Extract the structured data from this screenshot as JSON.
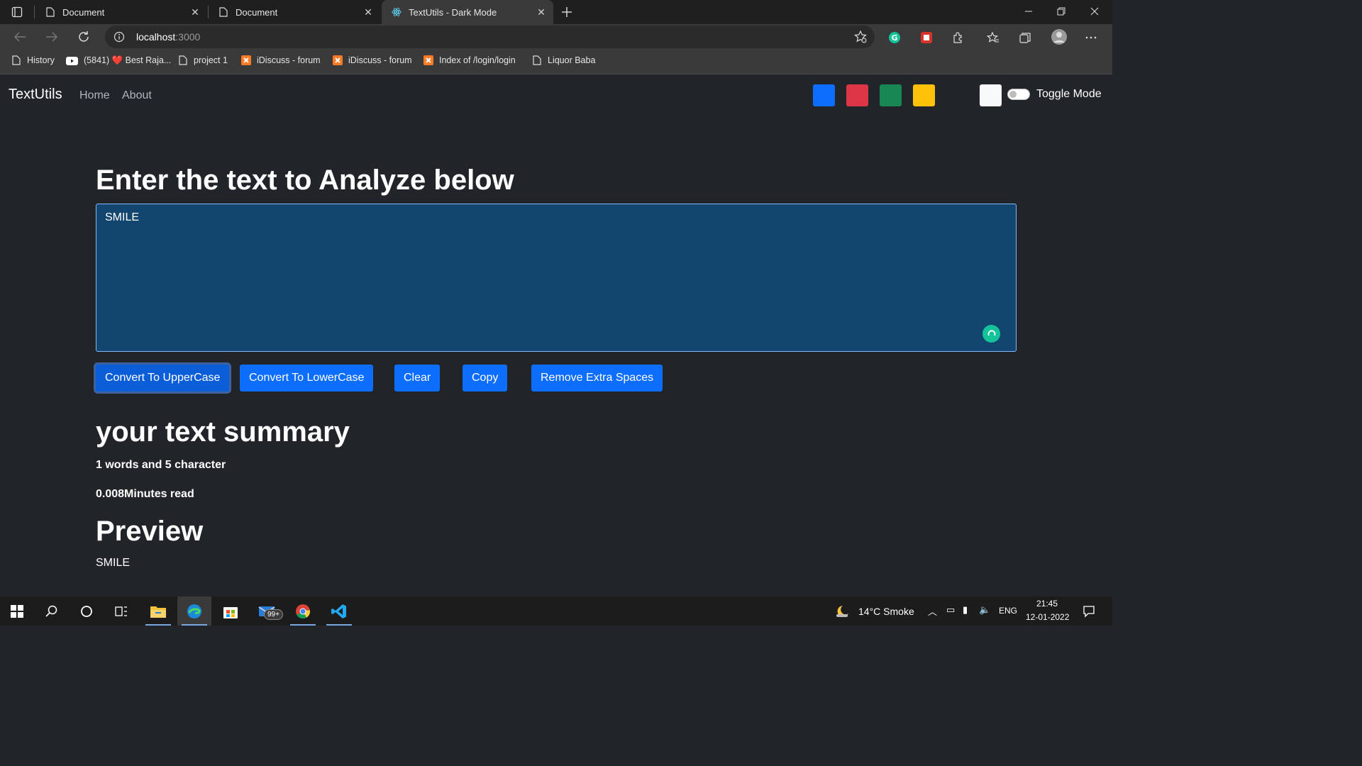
{
  "browser": {
    "tabs": [
      {
        "title": "Document",
        "icon": "page-icon",
        "active": false
      },
      {
        "title": "Document",
        "icon": "page-icon",
        "active": false
      },
      {
        "title": "TextUtils - Dark Mode",
        "icon": "react-icon",
        "active": true
      }
    ],
    "url_host": "localhost",
    "url_port": ":3000",
    "bookmarks": [
      {
        "label": "History",
        "icon": "page-icon"
      },
      {
        "label": "(5841) ❤️ Best Raja...",
        "icon": "youtube-icon"
      },
      {
        "label": "project 1",
        "icon": "page-icon"
      },
      {
        "label": "iDiscuss - forum",
        "icon": "xampp-icon"
      },
      {
        "label": "iDiscuss - forum",
        "icon": "xampp-icon"
      },
      {
        "label": "Index of /login/login",
        "icon": "xampp-icon"
      },
      {
        "label": "Liquor Baba",
        "icon": "page-icon"
      }
    ]
  },
  "navbar": {
    "brand": "TextUtils",
    "links": [
      "Home",
      "About"
    ],
    "color_swatches": [
      "#0d6efd",
      "#dc3545",
      "#198754",
      "#ffc107",
      "#f8f9fa"
    ],
    "toggle_label": "Toggle Mode",
    "toggle_on": false
  },
  "main": {
    "heading": "Enter the text to Analyze below",
    "textarea_value": "SMILE",
    "buttons": [
      "Convert To UpperCase",
      "Convert To LowerCase",
      "Clear",
      "Copy",
      "Remove Extra Spaces"
    ],
    "summary_title": "your text summary",
    "summary_counts": "1 words and 5 character",
    "read_time": "0.008Minutes read",
    "preview_title": "Preview",
    "preview_text": "SMILE"
  },
  "taskbar": {
    "weather": "14°C  Smoke",
    "language": "ENG",
    "time": "21:45",
    "date": "12-01-2022",
    "mail_badge": "99+"
  },
  "colors": {
    "page_bg": "#212529",
    "primary": "#0d6efd",
    "textarea_bg": "#13466e"
  }
}
